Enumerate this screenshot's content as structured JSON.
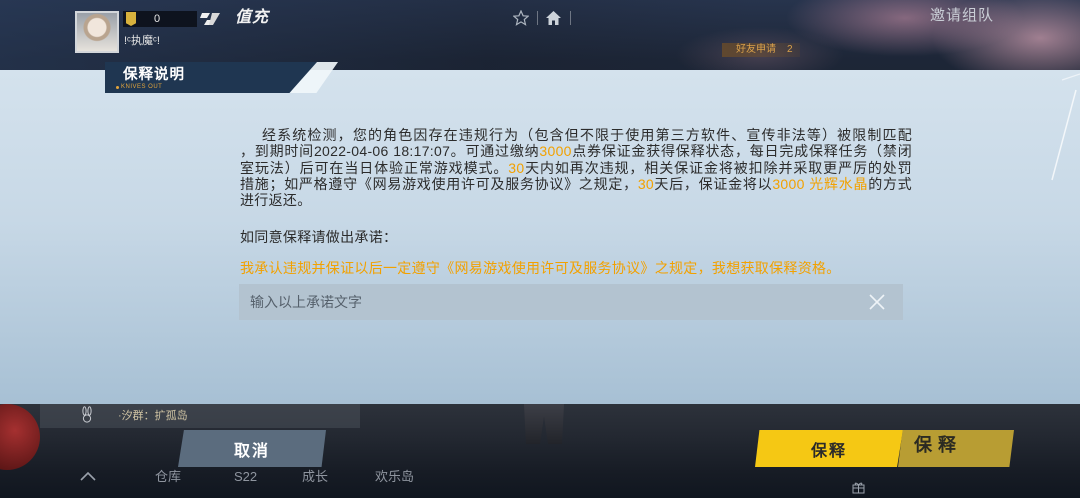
{
  "top_bar": {
    "player_name": "!ᶜ执魔ᶜ!",
    "level": "0",
    "recharge_label": "值充",
    "friend_request_label": "好友申请",
    "friend_request_count": "2",
    "invite_team_label": "邀请组队"
  },
  "notice": {
    "title": "保释说明",
    "brand": "KNIVES OUT",
    "lines": [
      [
        {
          "text": "经系统检测，您的角色因存在违规行为（包含但不限于使用第三方软件、宣传非法等）被限制匹配",
          "highlight": false
        }
      ],
      [
        {
          "text": "，到期时间2022-04-06 18:17:07。可通过缴纳",
          "highlight": false
        },
        {
          "text": "3000",
          "highlight": true
        },
        {
          "text": "点券保证金获得保释状态，每日完成保释任务（禁闭",
          "highlight": false
        }
      ],
      [
        {
          "text": "室玩法）后可在当日体验正常游戏模式。",
          "highlight": false
        },
        {
          "text": "30",
          "highlight": true
        },
        {
          "text": "天内如再次违规，相关保证金将被扣除并采取更严厉的处罚",
          "highlight": false
        }
      ],
      [
        {
          "text": "措施；如严格遵守《网易游戏使用许可及服务协议》之规定，",
          "highlight": false
        },
        {
          "text": "30",
          "highlight": true
        },
        {
          "text": "天后，保证金将以",
          "highlight": false
        },
        {
          "text": "3000 光辉水晶",
          "highlight": true
        },
        {
          "text": "的方式",
          "highlight": false
        }
      ],
      [
        {
          "text": "进行返还。",
          "highlight": false
        }
      ]
    ],
    "prompt": "如同意保释请做出承诺：",
    "pledge_text": "我承认违规并保证以后一定遵守《网易游戏使用许可及服务协议》之规定，我想获取保释资格。",
    "input": {
      "value": "",
      "placeholder": "输入以上承诺文字"
    }
  },
  "buttons": {
    "cancel_label": "取消",
    "bail_label": "保释",
    "bail_behind_label": "保释"
  },
  "lobby": {
    "group_label": "·汐群：扩孤岛",
    "nav": [
      "仓库",
      "S22",
      "成长",
      "欢乐岛"
    ]
  },
  "icons": {
    "rank": "rank-icon",
    "currency": "diamond-icon",
    "favorite": "star-icon",
    "home": "home-icon",
    "clear": "close-icon",
    "group": "rabbit-icon",
    "menu": "chevron-up-icon",
    "gift": "gift-icon"
  },
  "colors": {
    "highlight": "#f2a100",
    "panel_top": "#d4e2ed",
    "panel_bottom": "#a7c0d4",
    "cancel_button": "#5b6c7e",
    "bail_button": "#f5c814"
  }
}
